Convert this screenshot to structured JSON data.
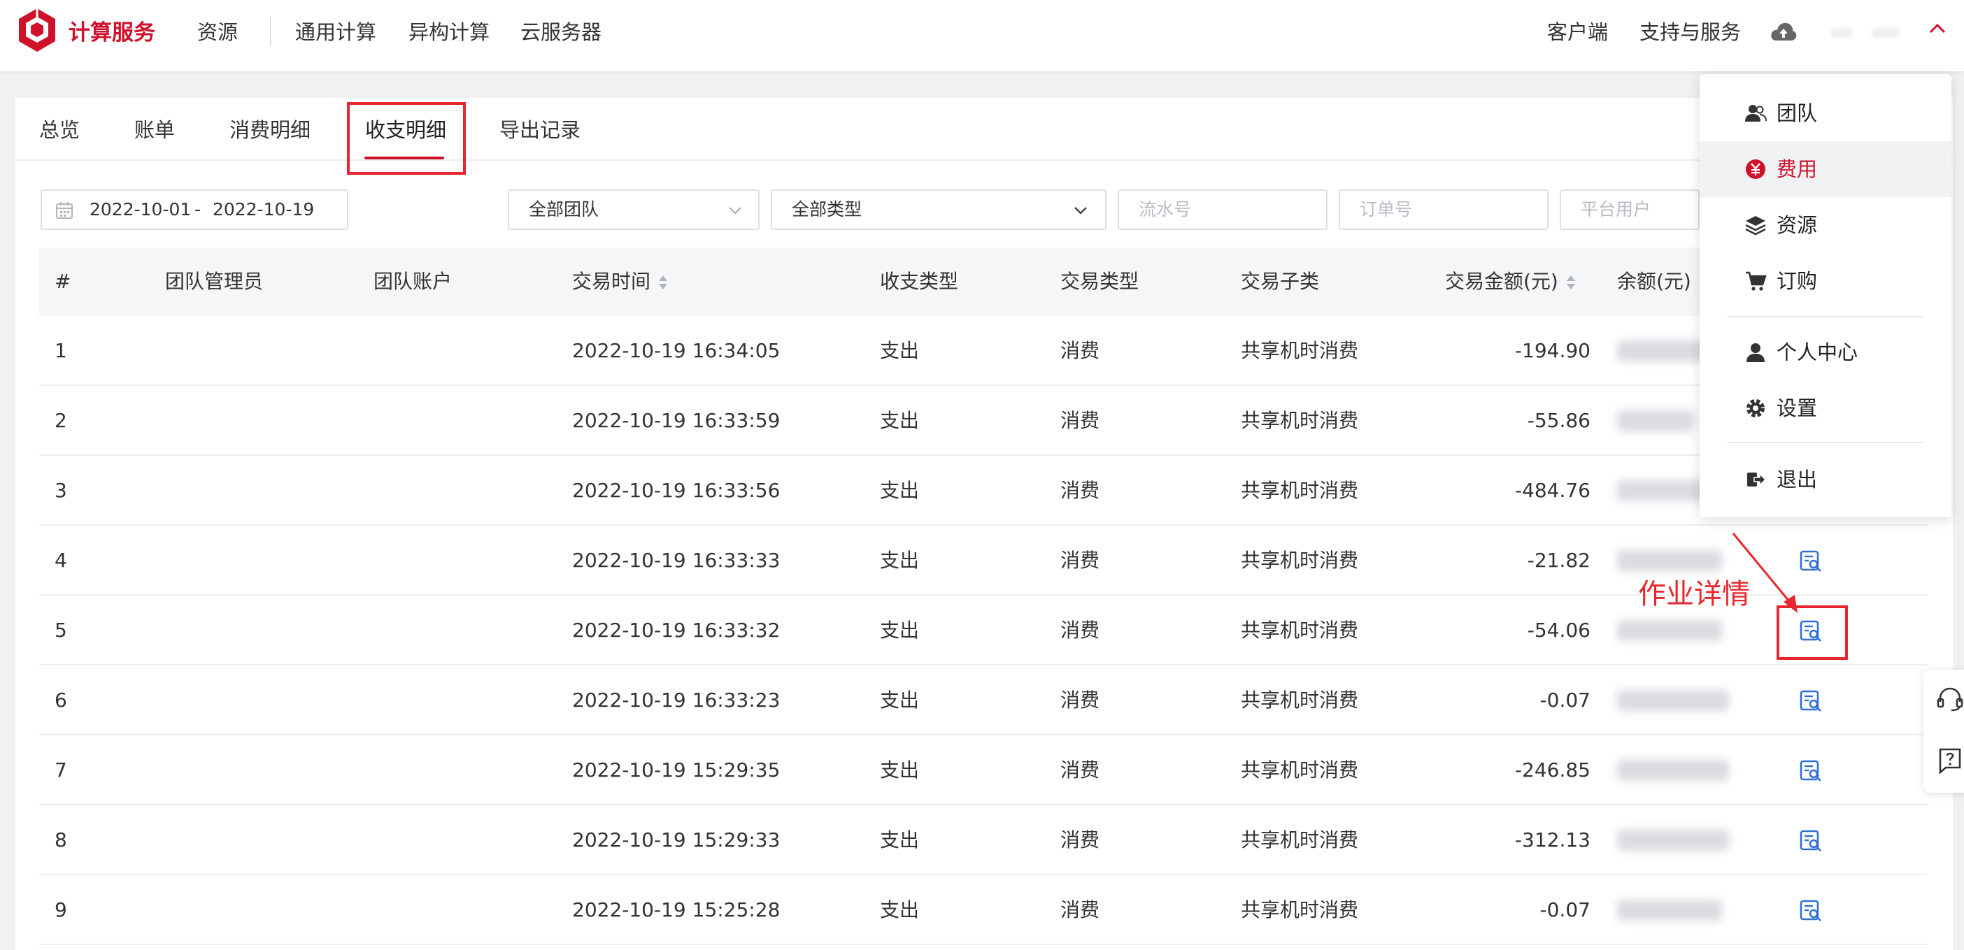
{
  "brand": {
    "name": "计算服务",
    "color": "#d0112b"
  },
  "nav": {
    "resources": "资源",
    "general_compute": "通用计算",
    "hetero_compute": "异构计算",
    "cloud_server": "云服务器",
    "client": "客户端",
    "support": "支持与服务"
  },
  "tabs": [
    {
      "label": "总览"
    },
    {
      "label": "账单"
    },
    {
      "label": "消费明细"
    },
    {
      "label": "收支明细",
      "active": true
    },
    {
      "label": "导出记录"
    }
  ],
  "filters": {
    "date_start": "2022-10-01",
    "date_sep": "-",
    "date_end": "2022-10-19",
    "team": "全部团队",
    "type": "全部类型",
    "serial_placeholder": "流水号",
    "order_placeholder": "订单号",
    "user_placeholder": "平台用户"
  },
  "table": {
    "headers": {
      "index": "#",
      "admin": "团队管理员",
      "account": "团队账户",
      "time": "交易时间",
      "io_type": "收支类型",
      "trade_type": "交易类型",
      "sub_type": "交易子类",
      "amount": "交易金额(元)",
      "balance": "余额(元)"
    },
    "rows": [
      {
        "index": "1",
        "time": "2022-10-19 16:34:05",
        "io_type": "支出",
        "trade_type": "消费",
        "sub_type": "共享机时消费",
        "amount": "-194.90"
      },
      {
        "index": "2",
        "time": "2022-10-19 16:33:59",
        "io_type": "支出",
        "trade_type": "消费",
        "sub_type": "共享机时消费",
        "amount": "-55.86"
      },
      {
        "index": "3",
        "time": "2022-10-19 16:33:56",
        "io_type": "支出",
        "trade_type": "消费",
        "sub_type": "共享机时消费",
        "amount": "-484.76"
      },
      {
        "index": "4",
        "time": "2022-10-19 16:33:33",
        "io_type": "支出",
        "trade_type": "消费",
        "sub_type": "共享机时消费",
        "amount": "-21.82"
      },
      {
        "index": "5",
        "time": "2022-10-19 16:33:32",
        "io_type": "支出",
        "trade_type": "消费",
        "sub_type": "共享机时消费",
        "amount": "-54.06"
      },
      {
        "index": "6",
        "time": "2022-10-19 16:33:23",
        "io_type": "支出",
        "trade_type": "消费",
        "sub_type": "共享机时消费",
        "amount": "-0.07"
      },
      {
        "index": "7",
        "time": "2022-10-19 15:29:35",
        "io_type": "支出",
        "trade_type": "消费",
        "sub_type": "共享机时消费",
        "amount": "-246.85"
      },
      {
        "index": "8",
        "time": "2022-10-19 15:29:33",
        "io_type": "支出",
        "trade_type": "消费",
        "sub_type": "共享机时消费",
        "amount": "-312.13"
      },
      {
        "index": "9",
        "time": "2022-10-19 15:25:28",
        "io_type": "支出",
        "trade_type": "消费",
        "sub_type": "共享机时消费",
        "amount": "-0.07"
      }
    ]
  },
  "annotation": {
    "text": "作业详情",
    "color": "#e8262d"
  },
  "user_menu": {
    "items": [
      {
        "label": "团队",
        "icon": "team-icon"
      },
      {
        "label": "费用",
        "icon": "yuan-icon",
        "active": true
      },
      {
        "label": "资源",
        "icon": "layers-icon"
      },
      {
        "label": "订购",
        "icon": "cart-icon"
      },
      {
        "label": "个人中心",
        "icon": "user-icon"
      },
      {
        "label": "设置",
        "icon": "gear-icon"
      },
      {
        "label": "退出",
        "icon": "logout-icon"
      }
    ]
  },
  "icons": {
    "logo": "cube-logo-icon",
    "cloud": "cloud-upload-icon",
    "detail": "job-detail-icon",
    "support": "headset-icon",
    "help": "help-icon"
  }
}
